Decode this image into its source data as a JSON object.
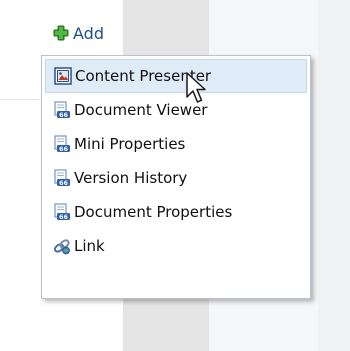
{
  "toolbar": {
    "add_label": "Add",
    "add_icon": "plus-icon"
  },
  "menu": {
    "items": [
      {
        "label": "Content Presenter",
        "icon": "content-presenter-icon",
        "highlighted": true
      },
      {
        "label": "Document Viewer",
        "icon": "document-viewer-icon",
        "highlighted": false
      },
      {
        "label": "Mini Properties",
        "icon": "mini-properties-icon",
        "highlighted": false
      },
      {
        "label": "Version History",
        "icon": "version-history-icon",
        "highlighted": false
      },
      {
        "label": "Document Properties",
        "icon": "document-properties-icon",
        "highlighted": false
      },
      {
        "label": "Link",
        "icon": "link-icon",
        "highlighted": false
      }
    ]
  },
  "colors": {
    "accent_text": "#1f4f8a",
    "highlight_bg": "#dfecf7",
    "plus_green": "#3a9b2e",
    "mid_pane": "#e4e4e4"
  }
}
